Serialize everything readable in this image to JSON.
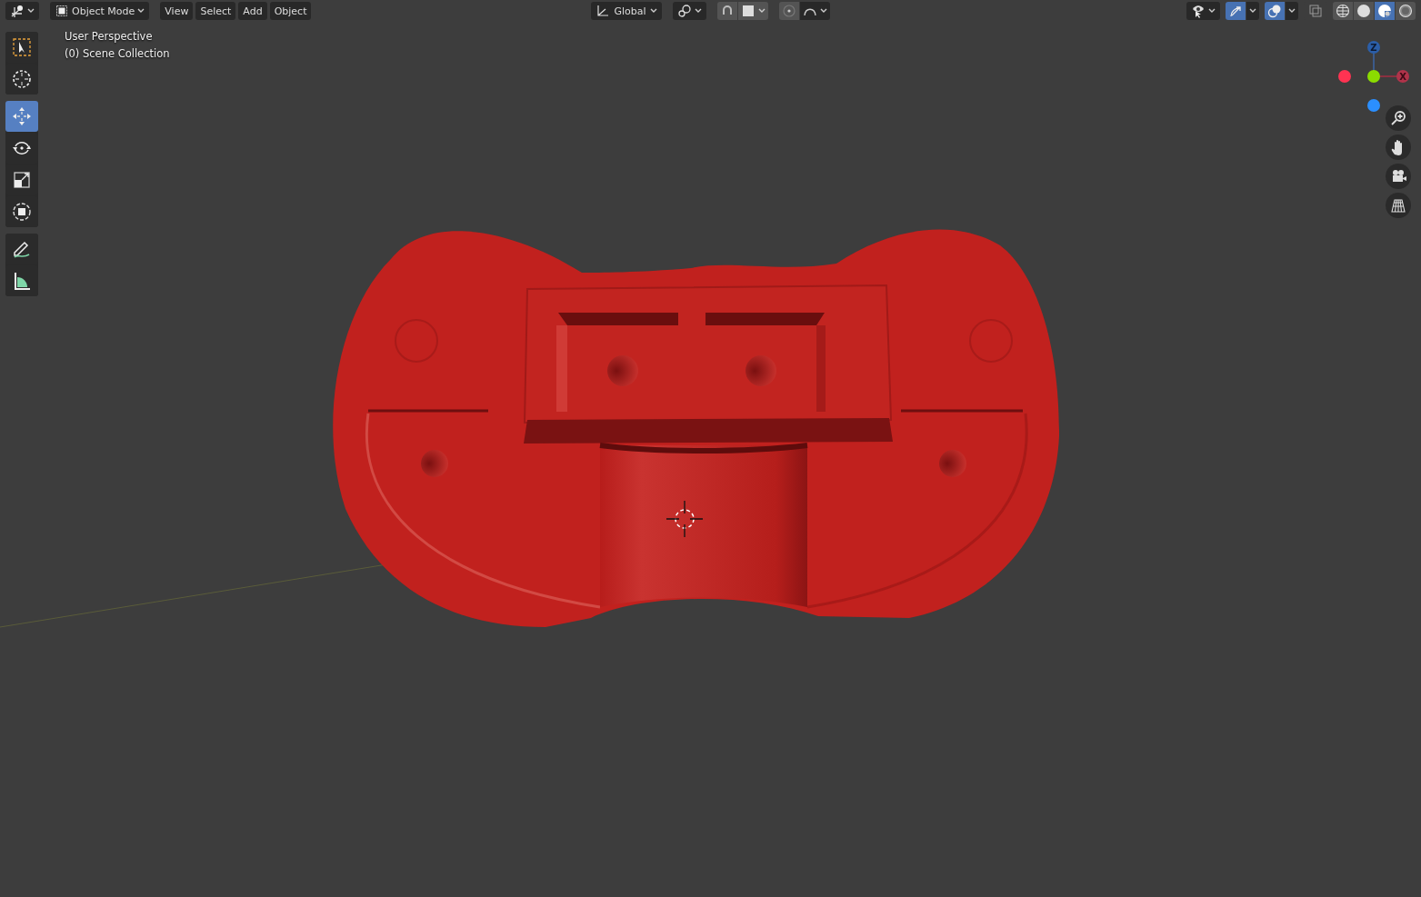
{
  "header": {
    "mode": {
      "label": "Object Mode"
    },
    "menus": [
      "View",
      "Select",
      "Add",
      "Object"
    ],
    "orientation": {
      "label": "Global"
    },
    "snap": {
      "on": false
    },
    "proportional": {
      "on": false
    },
    "gizmos": {
      "on": true
    },
    "overlays": {
      "on": true
    },
    "xray": {
      "on": false
    },
    "shading": [
      {
        "kind": "wireframe",
        "selected": false
      },
      {
        "kind": "solid",
        "selected": false
      },
      {
        "kind": "material",
        "selected": true
      },
      {
        "kind": "rendered",
        "selected": false
      }
    ]
  },
  "toolbar": [
    {
      "tools": [
        {
          "kind": "select",
          "selected": false
        },
        {
          "kind": "cursor",
          "selected": false
        }
      ]
    },
    {
      "tools": [
        {
          "kind": "move",
          "selected": true
        },
        {
          "kind": "rotate",
          "selected": false
        },
        {
          "kind": "scale",
          "selected": false
        },
        {
          "kind": "transform",
          "selected": false
        }
      ]
    },
    {
      "tools": [
        {
          "kind": "annotate",
          "selected": false
        },
        {
          "kind": "measure",
          "selected": false
        }
      ]
    }
  ],
  "viewport": {
    "info": [
      "User Perspective",
      "(0) Scene Collection"
    ]
  },
  "gizmo": {
    "axes": [
      {
        "kind": "z",
        "label": "Z"
      },
      {
        "kind": "x",
        "label": "X"
      }
    ]
  }
}
